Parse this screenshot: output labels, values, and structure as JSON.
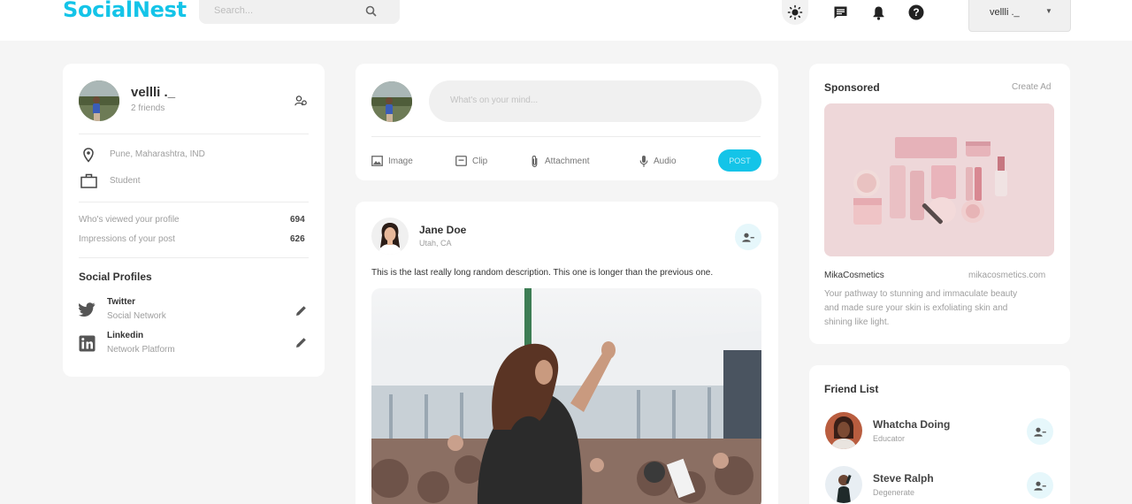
{
  "nav": {
    "logo": "SocialNest",
    "search_placeholder": "Search...",
    "user_name": "vellli ._",
    "icons": [
      "search-icon",
      "sun-icon",
      "message-icon",
      "bell-icon",
      "help-icon",
      "caret-down-icon"
    ],
    "accent": "#14c4e8"
  },
  "profile": {
    "name": "vellli ._",
    "friends": "2 friends",
    "location": "Pune, Maharashtra, IND",
    "occupation": "Student",
    "viewed_label": "Who's viewed your profile",
    "viewed_value": "694",
    "impressions_label": "Impressions of your post",
    "impressions_value": "626",
    "social_title": "Social Profiles",
    "socials": [
      {
        "name": "Twitter",
        "type": "Social Network"
      },
      {
        "name": "Linkedin",
        "type": "Network Platform"
      }
    ]
  },
  "composer": {
    "placeholder": "What's on your mind...",
    "actions": [
      "Image",
      "Clip",
      "Attachment",
      "Audio"
    ],
    "post_label": "POST"
  },
  "post": {
    "author": "Jane Doe",
    "location": "Utah, CA",
    "description": "This is the last really long random description. This one is longer than the previous one."
  },
  "sponsored": {
    "title": "Sponsored",
    "create_ad": "Create Ad",
    "brand": "MikaCosmetics",
    "url": "mikacosmetics.com",
    "text_lines": [
      "Your pathway to stunning and immaculate beauty",
      "and made sure your skin is exfoliating skin and",
      "shining like light."
    ]
  },
  "friends": {
    "title": "Friend List",
    "items": [
      {
        "name": "Whatcha Doing",
        "role": "Educator"
      },
      {
        "name": "Steve Ralph",
        "role": "Degenerate"
      }
    ]
  }
}
